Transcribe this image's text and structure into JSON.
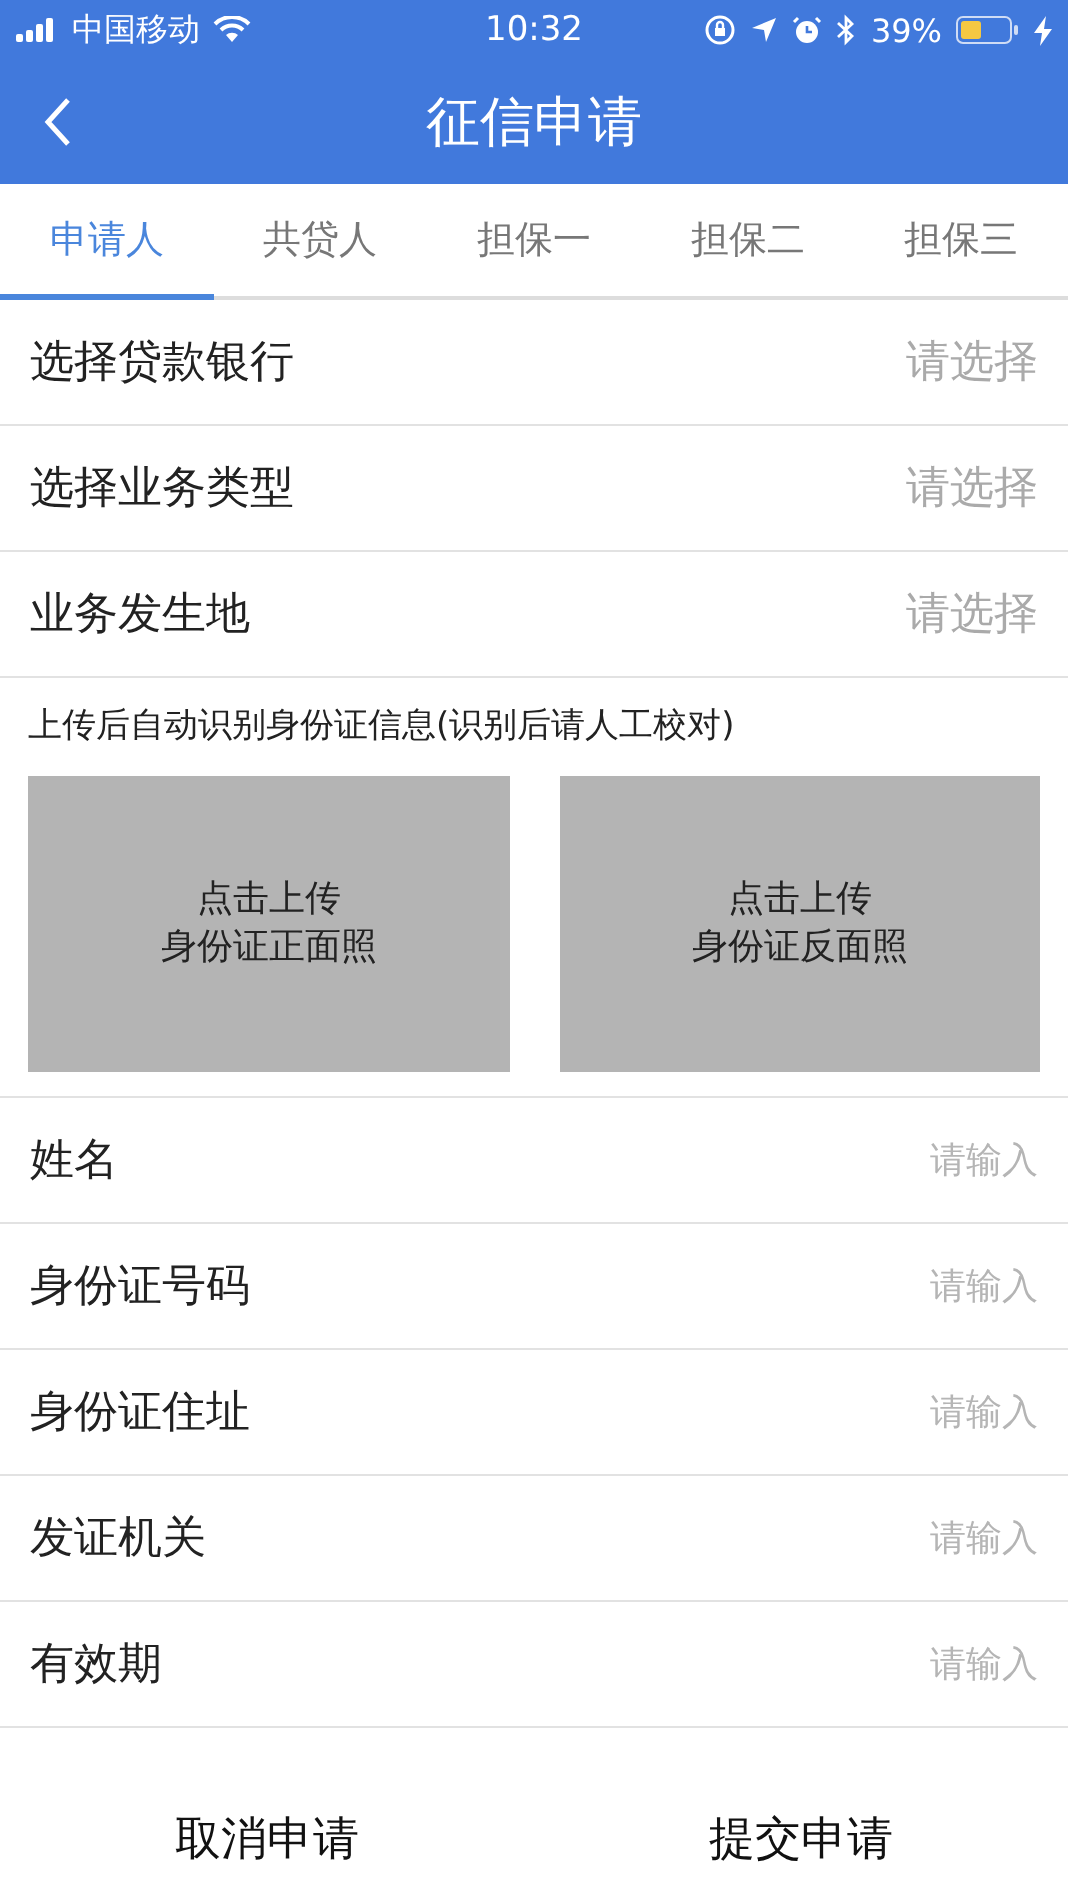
{
  "status_bar": {
    "carrier": "中国移动",
    "time": "10:32",
    "battery": "39%"
  },
  "nav": {
    "title": "征信申请"
  },
  "tabs": [
    {
      "label": "申请人",
      "selected": true
    },
    {
      "label": "共贷人",
      "selected": false
    },
    {
      "label": "担保一",
      "selected": false
    },
    {
      "label": "担保二",
      "selected": false
    },
    {
      "label": "担保三",
      "selected": false
    }
  ],
  "select_rows": [
    {
      "label": "选择贷款银行",
      "placeholder": "请选择"
    },
    {
      "label": "选择业务类型",
      "placeholder": "请选择"
    },
    {
      "label": "业务发生地",
      "placeholder": "请选择"
    }
  ],
  "upload": {
    "caption": "上传后自动识别身份证信息(识别后请人工校对)",
    "slots": [
      {
        "line1": "点击上传",
        "line2": "身份证正面照"
      },
      {
        "line1": "点击上传",
        "line2": "身份证反面照"
      }
    ]
  },
  "input_rows": [
    {
      "label": "姓名",
      "placeholder": "请输入"
    },
    {
      "label": "身份证号码",
      "placeholder": "请输入"
    },
    {
      "label": "身份证住址",
      "placeholder": "请输入"
    },
    {
      "label": "发证机关",
      "placeholder": "请输入"
    },
    {
      "label": "有效期",
      "placeholder": "请输入"
    }
  ],
  "footer": {
    "buttons": [
      "取消申请",
      "提交申请"
    ]
  }
}
